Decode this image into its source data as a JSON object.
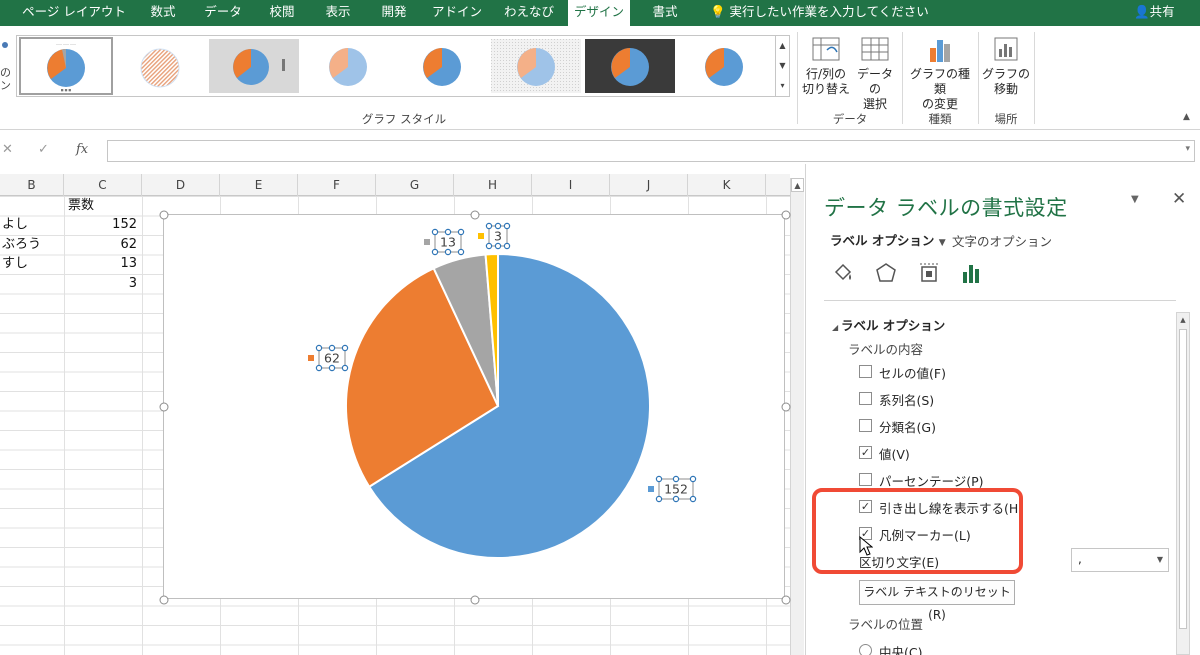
{
  "ribbon_tabs": [
    {
      "label": "ページ レイアウト",
      "active": false
    },
    {
      "label": "数式",
      "active": false
    },
    {
      "label": "データ",
      "active": false
    },
    {
      "label": "校閲",
      "active": false
    },
    {
      "label": "表示",
      "active": false
    },
    {
      "label": "開発",
      "active": false
    },
    {
      "label": "アドイン",
      "active": false
    },
    {
      "label": "わえなび",
      "active": false
    },
    {
      "label": "デザイン",
      "active": true
    },
    {
      "label": "書式",
      "active": false
    }
  ],
  "tell_me": "実行したい作業を入力してください",
  "share": "共有",
  "ribbon": {
    "left_partial": [
      "の",
      "ン"
    ],
    "gallery_label": "グラフ スタイル",
    "buttons": {
      "switch_row_col": "行/列の\n切り替え",
      "select_data": "データの\n選択",
      "change_type": "グラフの種類\nの変更",
      "move_chart": "グラフの\n移動"
    },
    "groups": {
      "data": "データ",
      "type": "種類",
      "location": "場所"
    }
  },
  "formula_bar": {
    "fx": "fx",
    "value": ""
  },
  "sheet": {
    "columns": [
      "B",
      "C",
      "D",
      "E",
      "F",
      "G",
      "H",
      "I",
      "J",
      "K"
    ],
    "header_value": "票数",
    "rows": [
      {
        "name": "よし",
        "votes": "152"
      },
      {
        "name": "ぶろう",
        "votes": "62"
      },
      {
        "name": "すし",
        "votes": "13"
      },
      {
        "name": "",
        "votes": "3"
      }
    ]
  },
  "chart_data": {
    "type": "pie",
    "values": [
      152,
      62,
      13,
      3
    ],
    "data_labels": [
      "152",
      "62",
      "13",
      "3"
    ],
    "colors": [
      "#5b9bd5",
      "#ed7d31",
      "#a5a5a5",
      "#ffc000"
    ],
    "start_angle_deg": 0,
    "direction": "clockwise"
  },
  "pane": {
    "title": "データ ラベルの書式設定",
    "tab_label_options": "ラベル オプション",
    "tab_text_options": "文字のオプション",
    "section_title": "ラベル オプション",
    "content_heading": "ラベルの内容",
    "options": [
      {
        "label": "セルの値(F)",
        "checked": false
      },
      {
        "label": "系列名(S)",
        "checked": false
      },
      {
        "label": "分類名(G)",
        "checked": false
      },
      {
        "label": "値(V)",
        "checked": true
      },
      {
        "label": "パーセンテージ(P)",
        "checked": false
      },
      {
        "label": "引き出し線を表示する(H)",
        "checked": true
      },
      {
        "label": "凡例マーカー(L)",
        "checked": true
      }
    ],
    "separator_label": "区切り文字(E)",
    "separator_value": ",",
    "reset_button": "ラベル テキストのリセット(R)",
    "position_heading": "ラベルの位置",
    "position_center": "中央(C)"
  },
  "highlight_color": "#f04a35",
  "accent_color": "#217346"
}
